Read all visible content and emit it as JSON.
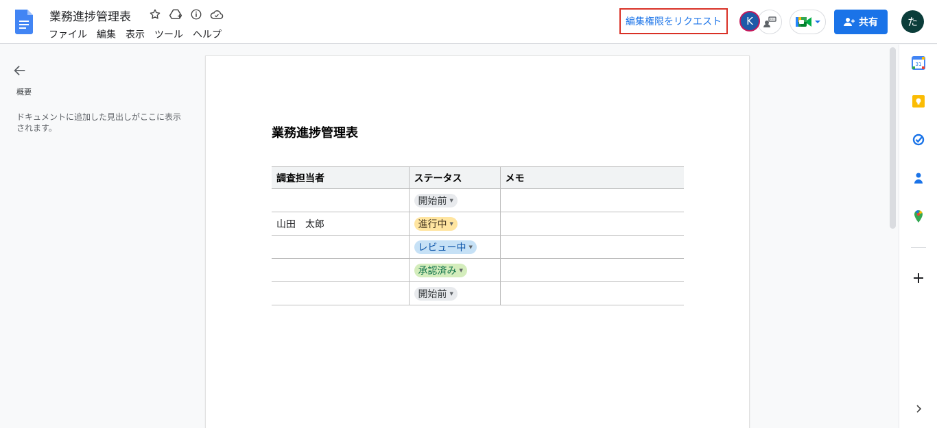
{
  "header": {
    "doc_title": "業務進捗管理表",
    "menu": [
      "ファイル",
      "編集",
      "表示",
      "ツール",
      "ヘルプ"
    ],
    "request_edit_label": "編集権限をリクエスト",
    "collaborator_initial": "K",
    "share_label": "共有",
    "user_initial": "た"
  },
  "outline": {
    "label": "概要",
    "empty_text": "ドキュメントに追加した見出しがここに表示されます。"
  },
  "document": {
    "heading": "業務進捗管理表",
    "table": {
      "headers": [
        "調査担当者",
        "ステータス",
        "メモ"
      ],
      "rows": [
        {
          "assignee": "",
          "status": "開始前",
          "memo": ""
        },
        {
          "assignee": "山田　太郎",
          "status": "進行中",
          "memo": ""
        },
        {
          "assignee": "",
          "status": "レビュー中",
          "memo": ""
        },
        {
          "assignee": "",
          "status": "承認済み",
          "memo": ""
        },
        {
          "assignee": "",
          "status": "開始前",
          "memo": ""
        }
      ]
    }
  },
  "status_colors": {
    "開始前": {
      "bg": "#e8eaed",
      "fg": "#3c4043"
    },
    "進行中": {
      "bg": "#ffe5a0",
      "fg": "#473821"
    },
    "レビュー中": {
      "bg": "#c6e1f6",
      "fg": "#0a53a8"
    },
    "承認済み": {
      "bg": "#d4edbc",
      "fg": "#11734b"
    }
  },
  "colors": {
    "accent": "#1a73e8",
    "highlight_border": "#d93025"
  }
}
